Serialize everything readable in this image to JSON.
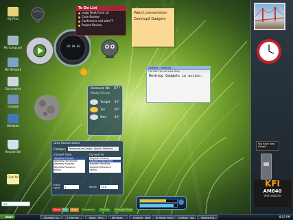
{
  "desktop_icons": [
    {
      "label": "My Files",
      "color": "#e6d37a"
    },
    {
      "label": "My Computer",
      "color": "#9fb5c8"
    },
    {
      "label": "My Network",
      "color": "#7aa3c9"
    },
    {
      "label": "Documents",
      "color": "#cfd8e0"
    },
    {
      "label": "Outlook",
      "color": "#6f8fb8"
    },
    {
      "label": "Windows",
      "color": "#3f7ab5"
    },
    {
      "label": "Recycle Bin",
      "color": "#cfe2ee"
    },
    {
      "label": "Click Me",
      "color": "#f8f0a0"
    }
  ],
  "media": {
    "time": "00:00:00"
  },
  "todo": {
    "title": "To Do List",
    "items": [
      "Legal Desk Form Ltr",
      "Code Review",
      "Conference call with IT",
      "Project Review"
    ]
  },
  "note": {
    "line1": "Watch presentation",
    "line2": "Desktop2 Gadgets"
  },
  "notepad": {
    "title": "Gadgets - Notepad",
    "menu": "File  Edit  Format  View  Help",
    "text": "Desktop Gadgets in action."
  },
  "weather": {
    "location": "Redmond, WA",
    "temp": "67°",
    "condition": "Mostly Cloudy",
    "forecast": [
      {
        "day": "Tonight",
        "temp": "52°"
      },
      {
        "day": "Tue",
        "temp": "66°"
      },
      {
        "day": "Wed",
        "temp": "63°"
      }
    ]
  },
  "converter": {
    "title": "Unit Conversions",
    "category_label": "Category",
    "category_value": "Temperature (angle, Speed, Volume)",
    "convert_from": "Convert from",
    "convert_to": "Convert to",
    "from_units": [
      "degrees Celsius",
      "degrees Fahrenheit",
      "degrees Rankine",
      "degrees Reaumur",
      "kelvin"
    ],
    "to_units": [
      "degrees Celsius",
      "degrees Fahrenheit",
      "degrees Rankine",
      "degrees Reaumur",
      "kelvin"
    ],
    "from_selected": 0,
    "to_selected": 1,
    "enter_label": "Enter value",
    "enter_value": "1",
    "result_label": "Result",
    "result_value": "33.8"
  },
  "sidebar": {
    "volume_text": "You have new Gmails",
    "kfi_brand": "KFI",
    "kfi_freq": "AM640",
    "kfi_link": "Visit website"
  },
  "bottom_bar": {
    "search": "Ask",
    "quicklinks": [
      "Music",
      "File",
      "Apps",
      "Standards",
      "Taskbar",
      "Explorer Tools"
    ]
  },
  "taskbar": {
    "start": "start",
    "items": [
      "Standalo Ga...",
      "2 Internet ...",
      "Inbox - Micr...",
      "Windows",
      "Untitled - Notepad",
      "Br Radio Friend",
      "Untitled - No...",
      "Seeing the..."
    ],
    "clock": "8:55 PM"
  }
}
